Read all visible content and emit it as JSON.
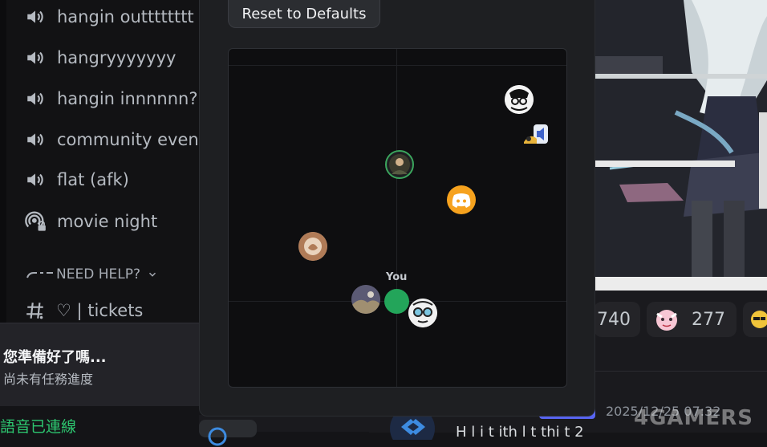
{
  "sidebar": {
    "channels": [
      {
        "label": "hangin outttttttt",
        "icon": "speaker-icon"
      },
      {
        "label": "hangryyyyyyy",
        "icon": "speaker-icon"
      },
      {
        "label": "hangin innnnnn??",
        "icon": "speaker-icon"
      },
      {
        "label": "community event",
        "icon": "speaker-icon"
      },
      {
        "label": "flat (afk)",
        "icon": "speaker-icon"
      },
      {
        "label": "movie night",
        "icon": "stage-lock-icon"
      }
    ],
    "category": {
      "label": "NEED HELP?"
    },
    "ticket_channel": {
      "label": "♡ | tickets",
      "icon": "hashtag-icon"
    }
  },
  "quest": {
    "title": "您準備好了嗎...",
    "subtitle": "尚未有任務進度"
  },
  "voice_status": "語音已連線",
  "panel": {
    "reset_button": "Reset to Defaults",
    "you_label": "You"
  },
  "reactions": [
    {
      "count": "740"
    },
    {
      "count": "277"
    }
  ],
  "message": {
    "timestamp": "2025/12/25 07:32",
    "text": "H l   i         t   ith      l   t  thi      t      2"
  },
  "watermark": "4GAMERS",
  "colors": {
    "speaking_ring": "#3ba55d",
    "you_dot": "#23a55a",
    "discord_orange": "#f6a21e",
    "role_tag": "#5865f2",
    "voice_connected": "#2dc770"
  }
}
